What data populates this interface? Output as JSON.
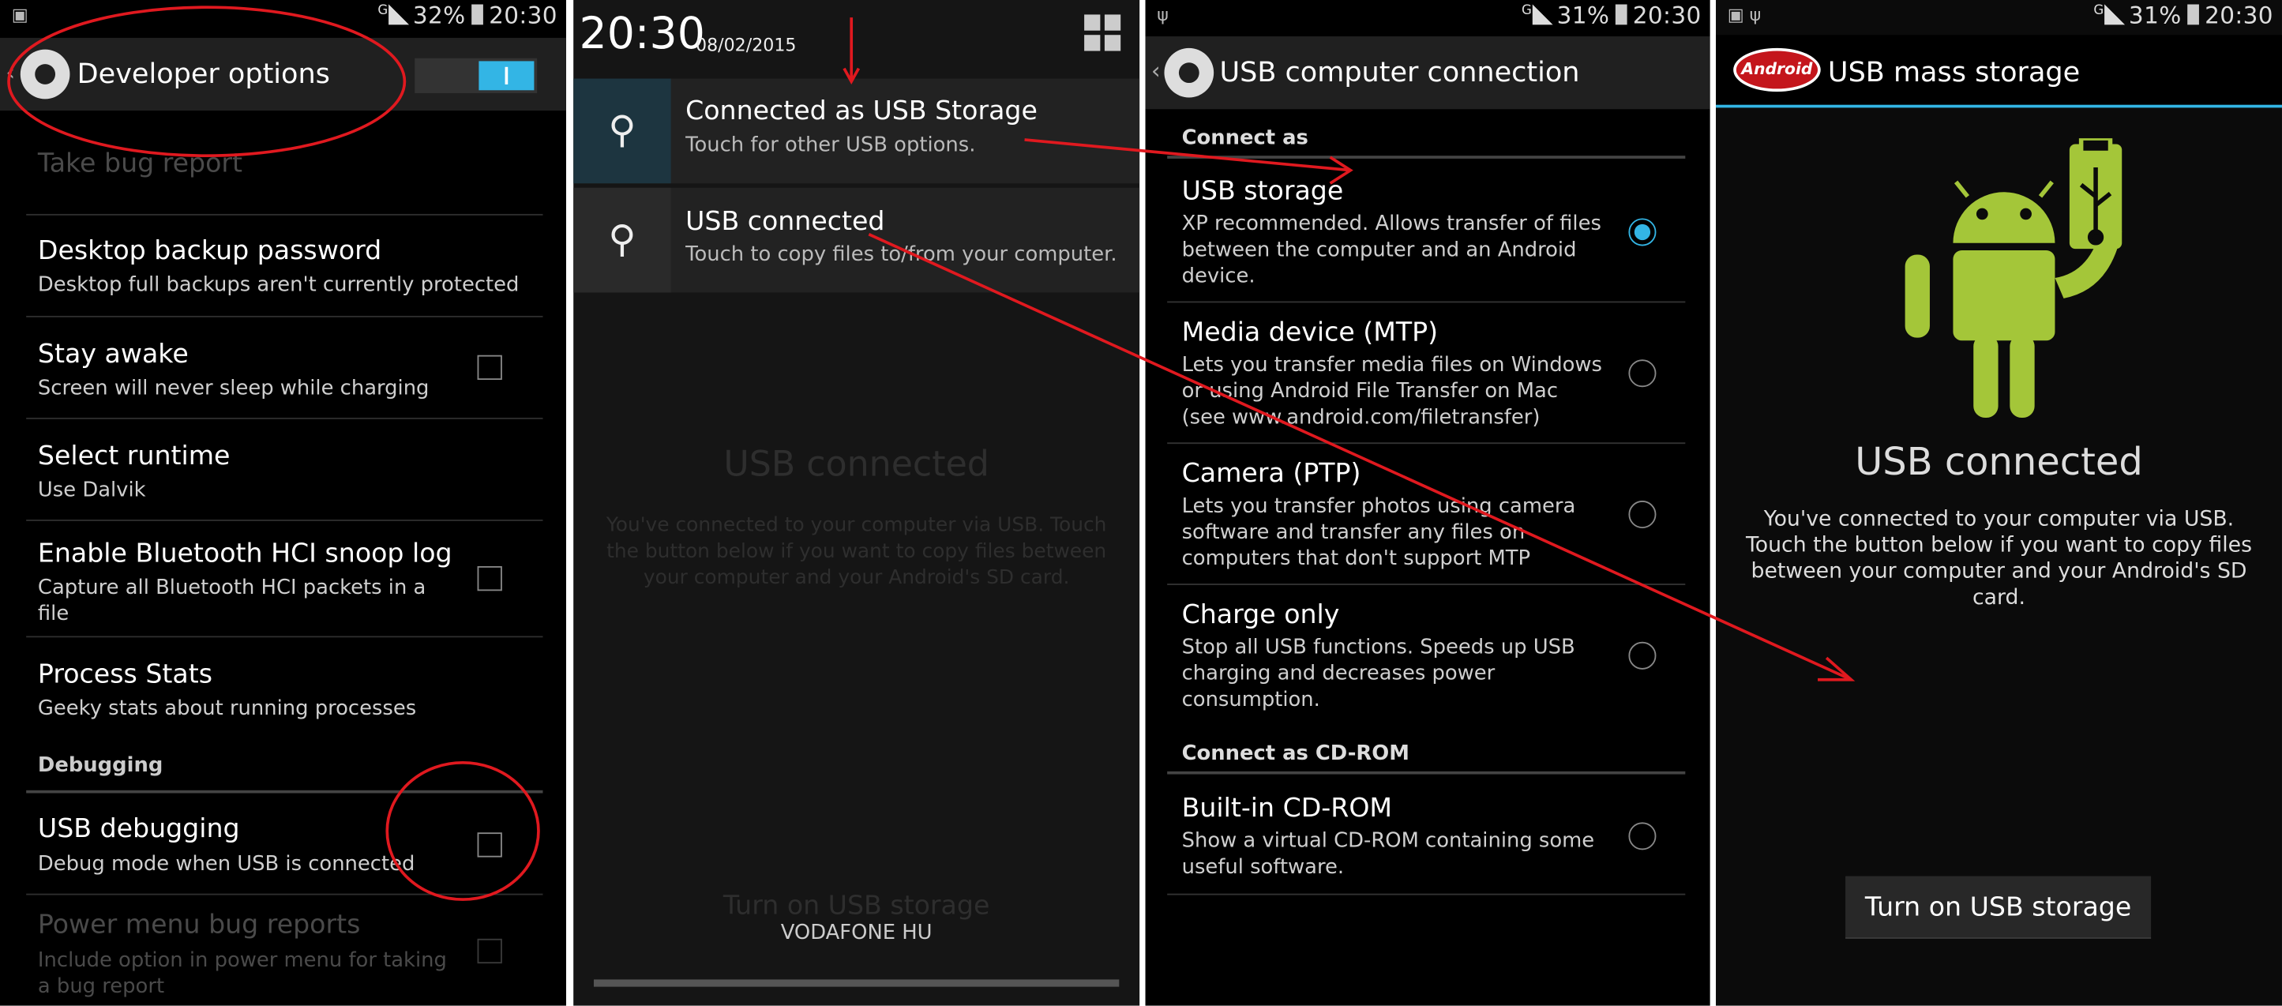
{
  "colors": {
    "accent": "#33b5e5",
    "annotation": "#e0191f",
    "android_green": "#a4c639"
  },
  "p1": {
    "status": {
      "battery": "32%",
      "time": "20:30",
      "net": "G"
    },
    "title": "Developer options",
    "rows": [
      {
        "title": "Take bug report",
        "subtitle": ""
      },
      {
        "title": "Desktop backup password",
        "subtitle": "Desktop full backups aren't currently protected"
      },
      {
        "title": "Stay awake",
        "subtitle": "Screen will never sleep while charging"
      },
      {
        "title": "Select runtime",
        "subtitle": "Use Dalvik"
      },
      {
        "title": "Enable Bluetooth HCI snoop log",
        "subtitle": "Capture all Bluetooth HCI packets in a file"
      },
      {
        "title": "Process Stats",
        "subtitle": "Geeky stats about running processes"
      },
      {
        "title": "USB debugging",
        "subtitle": "Debug mode when USB is connected"
      },
      {
        "title": "Power menu bug reports",
        "subtitle": "Include option in power menu for taking a bug report"
      }
    ],
    "section": "Debugging",
    "toggle_on": true
  },
  "p2": {
    "time": "20:30",
    "date": "08/02/2015",
    "notifications": [
      {
        "title": "Connected as USB Storage",
        "subtitle": "Touch for other USB options."
      },
      {
        "title": "USB connected",
        "subtitle": "Touch to copy files to/from your computer."
      }
    ],
    "ghost_title": "USB connected",
    "ghost_desc": "You've connected to your computer via USB. Touch the button below if you want to copy files between your computer and your Android's SD card.",
    "ghost_button": "Turn on USB storage",
    "carrier": "VODAFONE HU"
  },
  "p3": {
    "status": {
      "battery": "31%",
      "time": "20:30",
      "net": "G"
    },
    "title": "USB computer connection",
    "cat1": "Connect as",
    "cat2": "Connect as CD-ROM",
    "options": [
      {
        "title": "USB storage",
        "subtitle": "XP recommended. Allows transfer of files between the computer and an Android device.",
        "selected": true
      },
      {
        "title": "Media device (MTP)",
        "subtitle": "Lets you transfer media files on Windows or using Android File Transfer on Mac (see www.android.com/filetransfer)",
        "selected": false
      },
      {
        "title": "Camera (PTP)",
        "subtitle": "Lets you transfer photos using camera software and transfer any files on computers that don't support MTP",
        "selected": false
      },
      {
        "title": "Charge only",
        "subtitle": "Stop all USB functions. Speeds up USB charging and decreases power consumption.",
        "selected": false
      },
      {
        "title": "Built-in CD-ROM",
        "subtitle": "Show a virtual CD-ROM containing some useful software.",
        "selected": false
      }
    ]
  },
  "p4": {
    "status": {
      "battery": "31%",
      "time": "20:30",
      "net": "G"
    },
    "logo": "Android",
    "title": "USB mass storage",
    "heading": "USB connected",
    "description": "You've connected to your computer via USB. Touch the button below if you want to copy files between your computer and your Android's SD card.",
    "button": "Turn on USB storage"
  }
}
